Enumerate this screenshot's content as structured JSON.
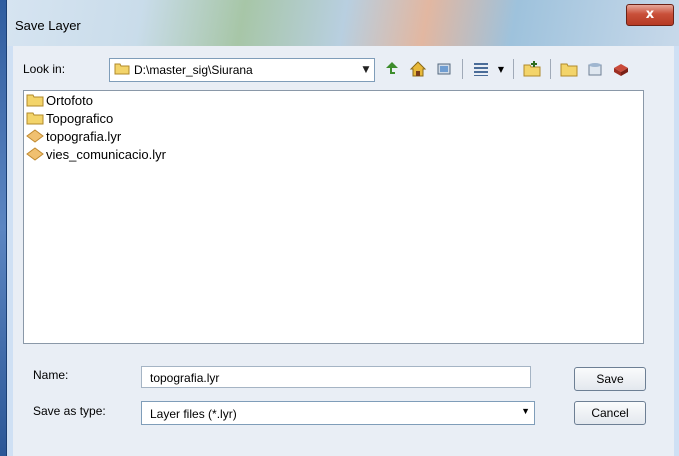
{
  "dialog": {
    "title": "Save Layer",
    "close_glyph": "x"
  },
  "look_in": {
    "label": "Look in:",
    "path": "D:\\master_sig\\Siurana"
  },
  "toolbar": {
    "icons": [
      "up-one-level-icon",
      "home-icon",
      "database-connect-icon",
      "view-menu-icon",
      "new-folder-icon",
      "folder-icon",
      "toolbox-icon",
      "catalog-icon"
    ]
  },
  "files": [
    {
      "name": "Ortofoto",
      "type": "folder"
    },
    {
      "name": "Topografico",
      "type": "folder"
    },
    {
      "name": "topografia.lyr",
      "type": "layer"
    },
    {
      "name": "vies_comunicacio.lyr",
      "type": "layer"
    }
  ],
  "name_field": {
    "label": "Name:",
    "value": "topografia.lyr"
  },
  "type_field": {
    "label": "Save as type:",
    "value": "Layer files (*.lyr)"
  },
  "buttons": {
    "save": "Save",
    "cancel": "Cancel"
  },
  "colors": {
    "close_button": "#c9503a",
    "folder_yellow": "#f3d46a",
    "layer_diamond": "#f0c070"
  }
}
